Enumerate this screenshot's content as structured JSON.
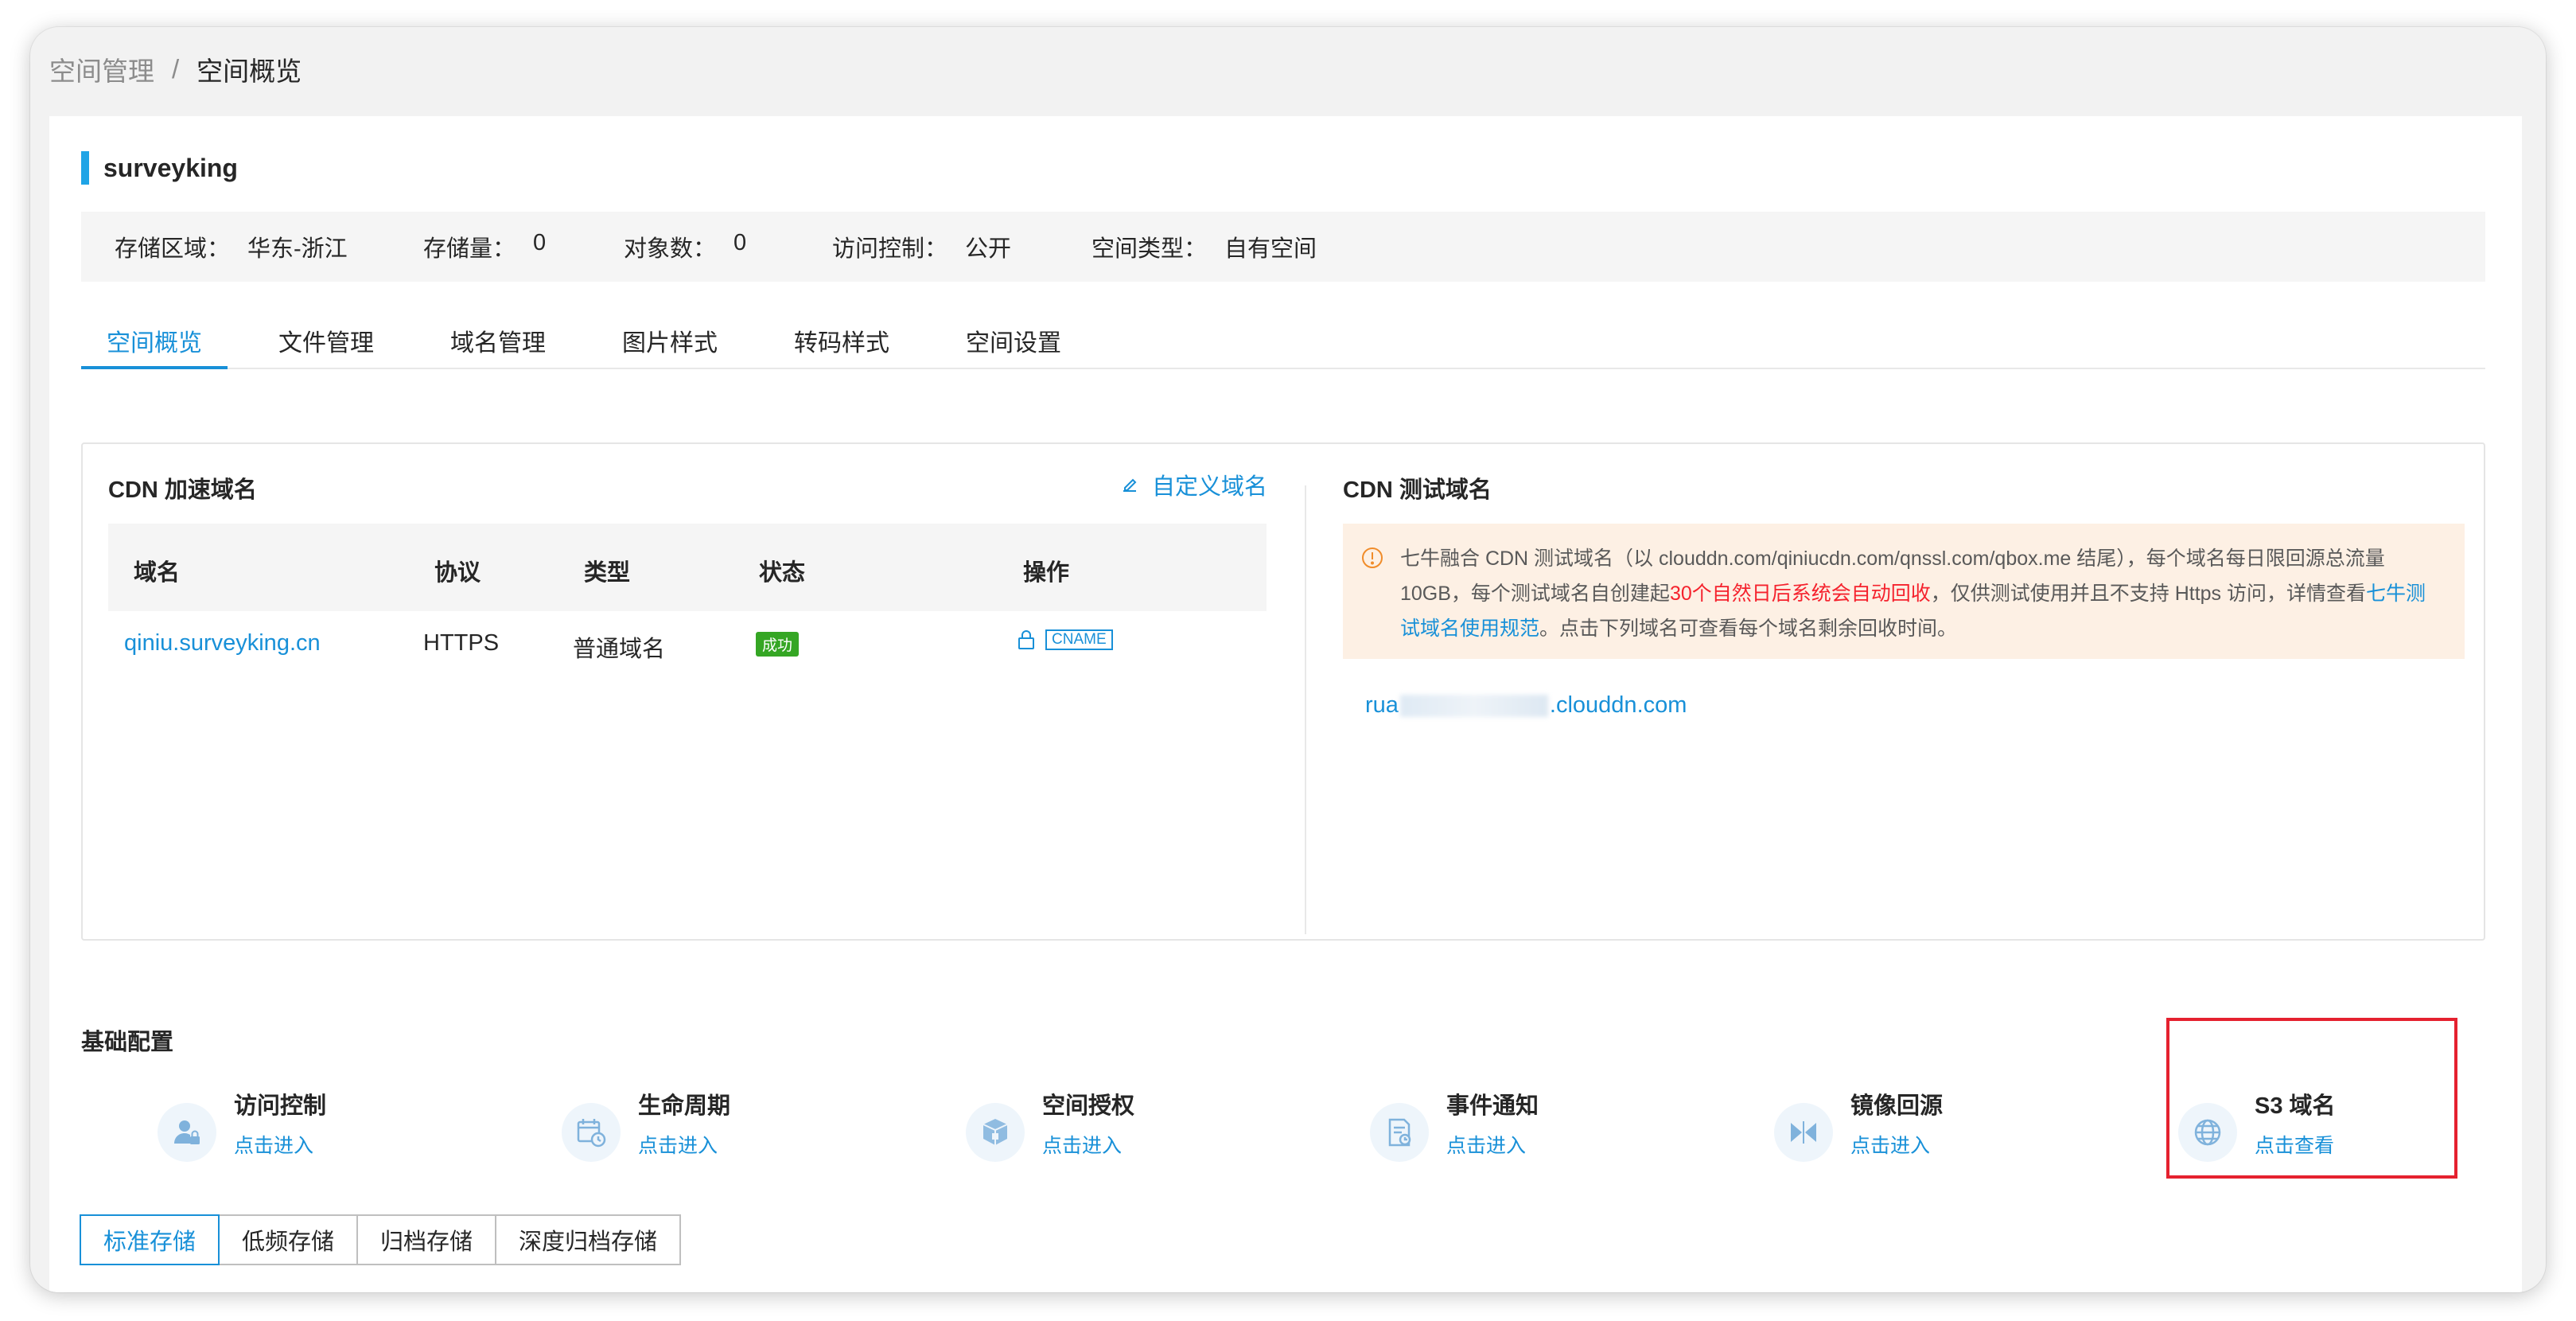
{
  "breadcrumb": {
    "parent": "空间管理",
    "separator": "/",
    "current": "空间概览"
  },
  "bucket": {
    "name": "surveyking"
  },
  "info": [
    {
      "key": "存储区域：",
      "value": "华东-浙江"
    },
    {
      "key": "存储量：",
      "value": "0"
    },
    {
      "key": "对象数：",
      "value": "0"
    },
    {
      "key": "访问控制：",
      "value": "公开"
    },
    {
      "key": "空间类型：",
      "value": "自有空间"
    }
  ],
  "tabs": [
    "空间概览",
    "文件管理",
    "域名管理",
    "图片样式",
    "转码样式",
    "空间设置"
  ],
  "active_tab_index": 0,
  "cdn": {
    "title": "CDN 加速域名",
    "custom_link": "自定义域名",
    "columns": [
      "域名",
      "协议",
      "类型",
      "状态",
      "操作"
    ],
    "row": {
      "domain": "qiniu.surveyking.cn",
      "protocol": "HTTPS",
      "type": "普通域名",
      "status": "成功",
      "op_tag": "CNAME"
    }
  },
  "test": {
    "title": "CDN 测试域名",
    "notice_part1": "七牛融合 CDN 测试域名（以 clouddn.com/qiniucdn.com/qnssl.com/qbox.me 结尾），每个域名每日限回源总流量 10GB，每个测试域名自创建起",
    "notice_red": "30个自然日后系统会自动回收",
    "notice_part2": "，仅供测试使用并且不支持 Https 访问，详情查看",
    "notice_link": "七牛测试域名使用规范",
    "notice_part3": "。点击下列域名可查看每个域名剩余回收时间。",
    "domain_prefix": "rua",
    "domain_suffix": ".clouddn.com"
  },
  "basic": {
    "title": "基础配置",
    "items": [
      {
        "label": "访问控制",
        "action": "点击进入",
        "icon": "user-lock-icon"
      },
      {
        "label": "生命周期",
        "action": "点击进入",
        "icon": "calendar-clock-icon"
      },
      {
        "label": "空间授权",
        "action": "点击进入",
        "icon": "box-icon"
      },
      {
        "label": "事件通知",
        "action": "点击进入",
        "icon": "document-notice-icon"
      },
      {
        "label": "镜像回源",
        "action": "点击进入",
        "icon": "mirror-icon"
      },
      {
        "label": "S3 域名",
        "action": "点击查看",
        "icon": "globe-icon"
      }
    ]
  },
  "storage_tabs": [
    "标准存储",
    "低频存储",
    "归档存储",
    "深度归档存储"
  ],
  "colors": {
    "accent": "#1890d8",
    "success": "#35a624",
    "warning_bg": "#fdf0e4",
    "danger": "#f5222d",
    "highlight": "#e5212f"
  }
}
